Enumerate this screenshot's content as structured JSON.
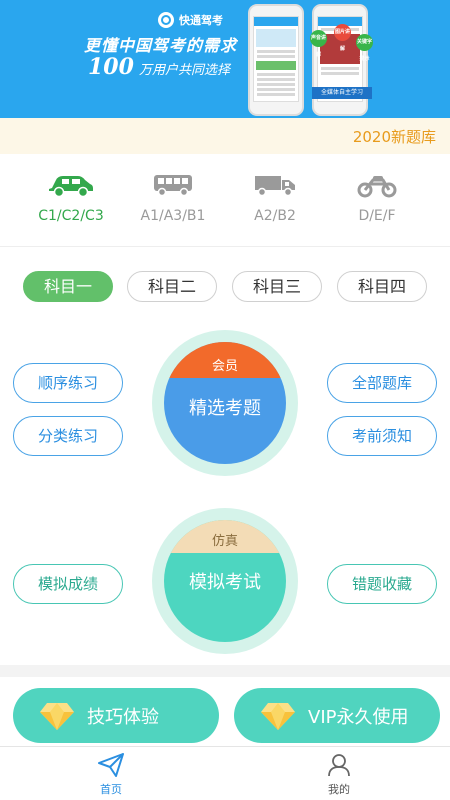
{
  "banner": {
    "brand_name": "快通驾考",
    "slogan": "更懂中国驾考的需求",
    "users_number": "100",
    "users_text": "万用户共同选择",
    "phone_bubbles": [
      "声音讲解",
      "图片讲解",
      "关键字提示"
    ],
    "phone_tag": "全媒体自主学习"
  },
  "notice": {
    "text": "2020新题库"
  },
  "vehicles": [
    {
      "label": "C1/C2/C3",
      "icon": "car-icon",
      "active": true
    },
    {
      "label": "A1/A3/B1",
      "icon": "bus-icon",
      "active": false
    },
    {
      "label": "A2/B2",
      "icon": "truck-icon",
      "active": false
    },
    {
      "label": "D/E/F",
      "icon": "motorcycle-icon",
      "active": false
    }
  ],
  "subjects": [
    {
      "label": "科目一",
      "active": true
    },
    {
      "label": "科目二",
      "active": false
    },
    {
      "label": "科目三",
      "active": false
    },
    {
      "label": "科目四",
      "active": false
    }
  ],
  "practice": {
    "left": [
      "顺序练习",
      "分类练习"
    ],
    "right": [
      "全部题库",
      "考前须知"
    ],
    "circle_tag": "会员",
    "circle_title": "精选考题"
  },
  "exam": {
    "left": "模拟成绩",
    "right": "错题收藏",
    "circle_tag": "仿真",
    "circle_title": "模拟考试"
  },
  "actions": [
    {
      "label": "技巧体验",
      "icon": "diamond-icon"
    },
    {
      "label": "VIP永久使用",
      "icon": "diamond-icon"
    }
  ],
  "tabbar": [
    {
      "label": "首页",
      "icon": "paper-plane-icon",
      "active": true
    },
    {
      "label": "我的",
      "icon": "user-icon",
      "active": false
    }
  ],
  "colors": {
    "banner": "#2aa6ee",
    "active_green": "#62c06a",
    "practice_circle": "#4a9ce8",
    "practice_tag": "#f26a2b",
    "exam_circle": "#4dd6c0",
    "exam_tag": "#f3dcb6",
    "accent_blue": "#2b8fe0"
  }
}
